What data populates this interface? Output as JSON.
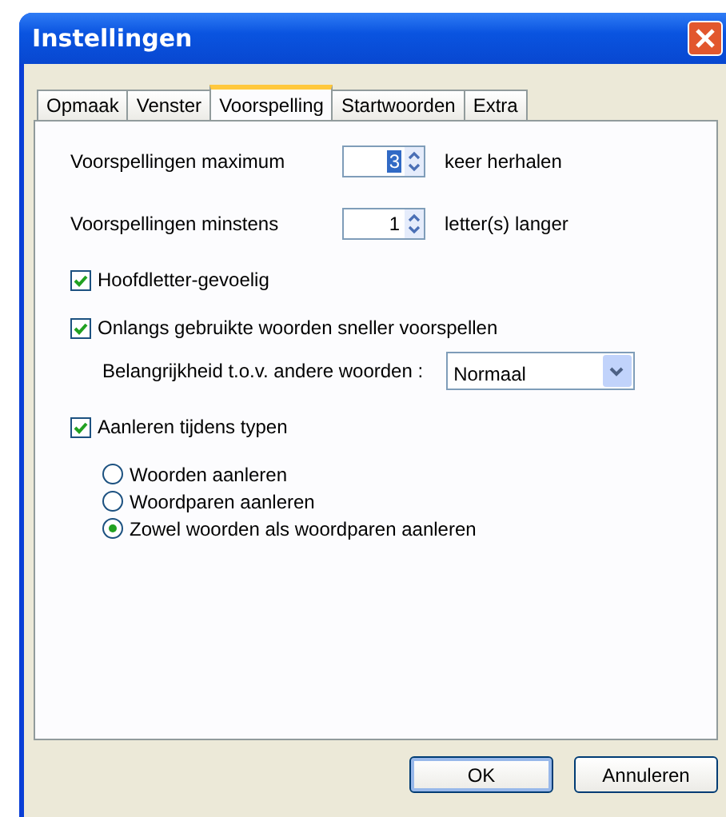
{
  "window": {
    "title": "Instellingen"
  },
  "tabs": [
    {
      "label": "Opmaak",
      "selected": false
    },
    {
      "label": "Venster",
      "selected": false
    },
    {
      "label": "Voorspelling",
      "selected": true
    },
    {
      "label": "Startwoorden",
      "selected": false
    },
    {
      "label": "Extra",
      "selected": false
    }
  ],
  "settings": [
    {
      "kind": "spin",
      "label": "Voorspellingen maximum",
      "value": "3",
      "suffix": "keer herhalen",
      "highlighted": true
    },
    {
      "kind": "spin",
      "label": "Voorspellingen minstens",
      "value": "1",
      "suffix": "letter(s) langer",
      "highlighted": false
    },
    {
      "kind": "checkbox",
      "label": "Hoofdletter-gevoelig",
      "checked": true
    },
    {
      "kind": "checkbox",
      "label": "Onlangs gebruikte woorden sneller voorspellen",
      "checked": true
    },
    {
      "kind": "dropdown",
      "label": "Belangrijkheid t.o.v. andere woorden :",
      "value": "Normaal"
    },
    {
      "kind": "checkbox",
      "label": "Aanleren tijdens typen",
      "checked": true
    },
    {
      "kind": "radio",
      "label": "Woorden aanleren",
      "selected": false
    },
    {
      "kind": "radio",
      "label": "Woordparen aanleren",
      "selected": false
    },
    {
      "kind": "radio",
      "label": "Zowel woorden als woordparen aanleren",
      "selected": true
    }
  ],
  "buttons": [
    {
      "label": "OK",
      "default": true
    },
    {
      "label": "Annuleren",
      "default": false
    }
  ]
}
